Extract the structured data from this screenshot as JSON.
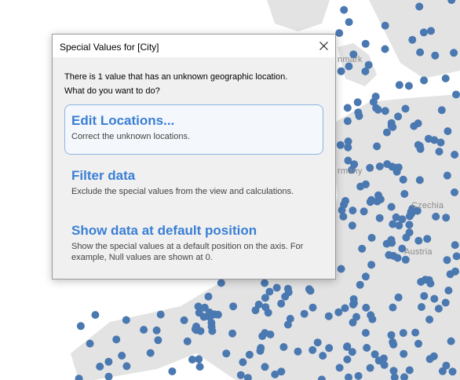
{
  "map": {
    "labels": [
      "nmark",
      "rmany",
      "Czechia",
      "Austria"
    ],
    "dot_color": "#4a78b0",
    "land_color": "#e3e3e3",
    "water_color": "#ffffff"
  },
  "dialog": {
    "title": "Special Values for [City]",
    "message_line1": "There is 1 value that has an unknown geographic location.",
    "message_line2": "What do you want to do?",
    "options": [
      {
        "title": "Edit Locations...",
        "description": "Correct the unknown locations."
      },
      {
        "title": "Filter data",
        "description": "Exclude the special values from the view and calculations."
      },
      {
        "title": "Show data at default position",
        "description_line1": "Show the special values at a default position on the axis. For",
        "description_line2": "example, Null values are shown at 0."
      }
    ],
    "accent_color": "#3a7fd5"
  }
}
